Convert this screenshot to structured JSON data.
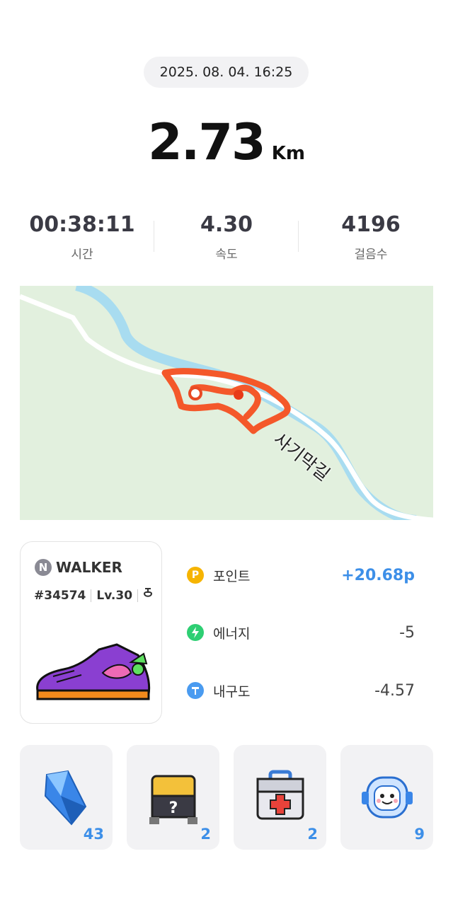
{
  "record": {
    "datetime": "2025. 08. 04. 16:25",
    "distance": "2.73",
    "distance_unit": "Km"
  },
  "stats": [
    {
      "value": "00:38:11",
      "label": "시간"
    },
    {
      "value": "4.30",
      "label": "속도"
    },
    {
      "value": "4196",
      "label": "걸음수"
    }
  ],
  "map": {
    "road_label": "사기막길",
    "route_color": "#f4582a"
  },
  "shoe": {
    "brand_badge": "N",
    "brand_name": "WALKER",
    "id": "#34574",
    "level": "Lv.30",
    "icon": "shoe-type-icon"
  },
  "rewards": [
    {
      "icon": "point-icon",
      "label": "포인트",
      "value": "+20.68p",
      "color": "#f6b400"
    },
    {
      "icon": "energy-icon",
      "label": "에너지",
      "value": "-5",
      "color": "#2ecf73"
    },
    {
      "icon": "durability-icon",
      "label": "내구도",
      "value": "-4.57",
      "color": "#4a9bf0"
    }
  ],
  "items": [
    {
      "name": "crystal-icon",
      "count": "43"
    },
    {
      "name": "mystery-box-icon",
      "count": "2"
    },
    {
      "name": "first-aid-kit-icon",
      "count": "2"
    },
    {
      "name": "astronaut-helmet-icon",
      "count": "9"
    }
  ],
  "colors": {
    "accent": "#3d8fe8",
    "map_bg": "#e2f0de",
    "river": "#a8dcf0"
  }
}
